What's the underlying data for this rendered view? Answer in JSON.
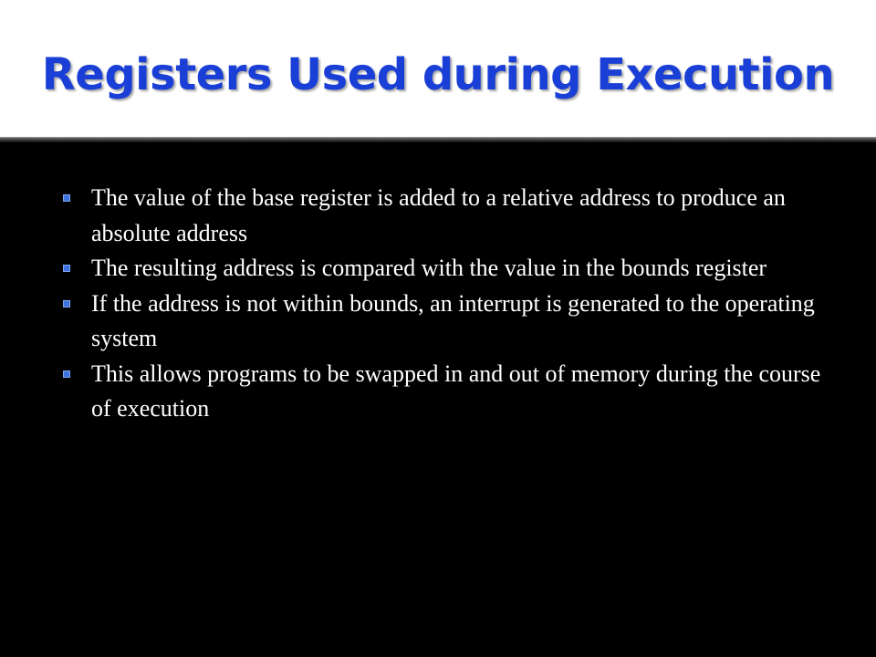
{
  "slide": {
    "title": "Registers Used during Execution",
    "colors": {
      "title": "#1a3fd6",
      "title_background": "#ffffff",
      "body_background": "#000000",
      "body_text": "#ffffff",
      "bullet": "#3c73e0"
    },
    "bullet_icon": "square-bullet-icon",
    "bullets": [
      {
        "text": "The value of the base register is added to a relative address to produce an absolute address"
      },
      {
        "text": "The resulting address is compared with the value in the bounds register"
      },
      {
        "text": "If the address is not within bounds, an interrupt is generated to the operating system"
      },
      {
        "text": "This allows programs to be swapped in and out of memory during the course of execution"
      }
    ]
  }
}
